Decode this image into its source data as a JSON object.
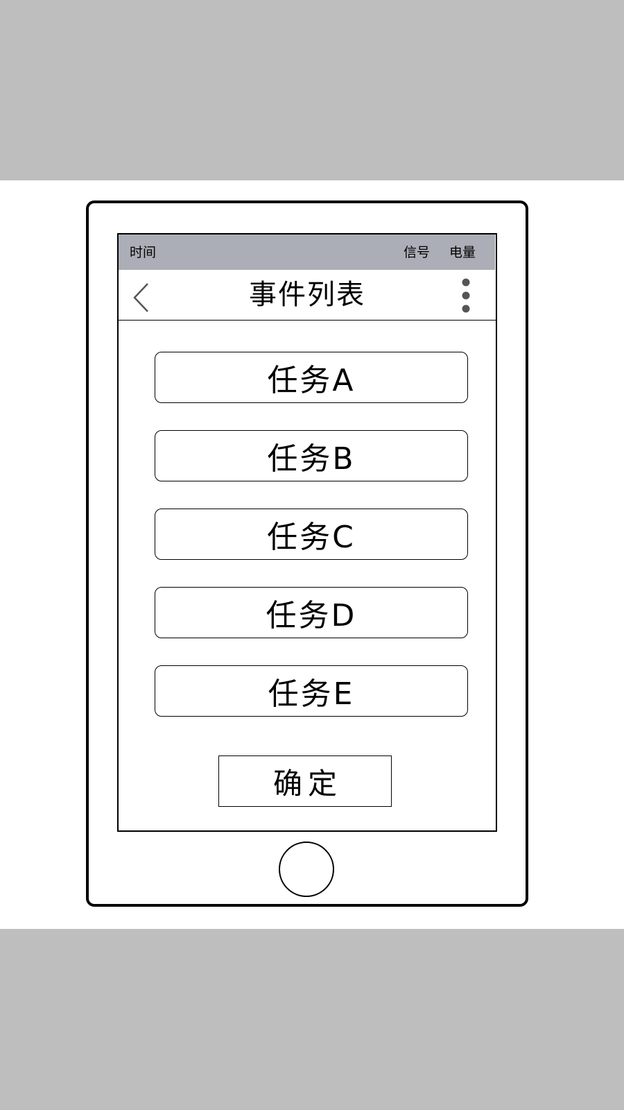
{
  "status_bar": {
    "time": "时间",
    "signal": "信号",
    "battery": "电量",
    "background": "#abaeb6"
  },
  "nav": {
    "back_icon": "chevron-left-icon",
    "title": "事件列表",
    "more_icon": "vertical-dots-icon"
  },
  "tasks": [
    {
      "label": "任务A"
    },
    {
      "label": "任务B"
    },
    {
      "label": "任务C"
    },
    {
      "label": "任务D"
    },
    {
      "label": "任务E"
    }
  ],
  "confirm": {
    "label": "确定"
  },
  "home_button_icon": "circle-icon",
  "colors": {
    "backdrop": "#bebebe",
    "outline": "#000000"
  }
}
